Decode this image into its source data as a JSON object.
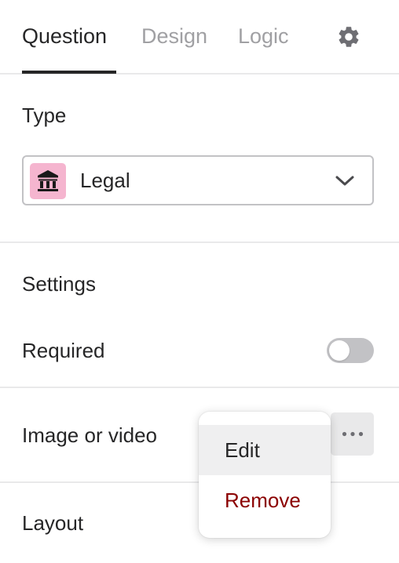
{
  "tabs": {
    "question": "Question",
    "design": "Design",
    "logic": "Logic"
  },
  "type_section": {
    "title": "Type",
    "selected": "Legal"
  },
  "settings_section": {
    "title": "Settings",
    "required_label": "Required",
    "required_enabled": false
  },
  "media_section": {
    "label": "Image or video"
  },
  "menu": {
    "edit": "Edit",
    "remove": "Remove"
  },
  "layout_section": {
    "title": "Layout"
  },
  "colors": {
    "accent_text": "#262627",
    "muted_tab": "#a0a0a3",
    "type_icon_bg": "#f5b5cf",
    "remove_text": "#8b0000",
    "toggle_off": "#c2c2c5"
  },
  "icons": {
    "settings": "gear-icon",
    "type": "bank-icon",
    "dropdown": "chevron-down-icon",
    "more": "more-horizontal-icon"
  }
}
